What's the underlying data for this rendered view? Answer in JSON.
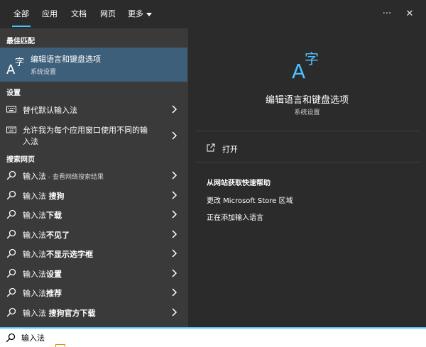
{
  "tabs": [
    {
      "label": "全部",
      "active": true
    },
    {
      "label": "应用",
      "active": false
    },
    {
      "label": "文档",
      "active": false
    },
    {
      "label": "网页",
      "active": false
    },
    {
      "label": "更多",
      "active": false
    }
  ],
  "topbar": {
    "more_options": "···",
    "close": "✕"
  },
  "best_match": {
    "section": "最佳匹配",
    "title": "编辑语言和键盘选项",
    "subtitle": "系统设置",
    "icon": "language-icon"
  },
  "settings": {
    "section": "设置",
    "items": [
      {
        "label": "替代默认输入法",
        "icon": "keyboard-icon"
      },
      {
        "label_line1": "允许我为每个应用窗口使用不同的输",
        "label_line2": "入法",
        "icon": "keyboard-icon"
      }
    ]
  },
  "web": {
    "section": "搜索网页",
    "items": [
      {
        "prefix": "输入法",
        "suffix": " - 查看网络搜索结果"
      },
      {
        "prefix": "输入法 ",
        "bold": "搜狗"
      },
      {
        "prefix": "输入法",
        "bold": "下载"
      },
      {
        "prefix": "输入法",
        "bold": "不见了"
      },
      {
        "prefix": "输入法",
        "bold": "不显示选字框"
      },
      {
        "prefix": "输入法",
        "bold": "设置"
      },
      {
        "prefix": "输入法",
        "bold": "推荐"
      },
      {
        "prefix": "输入法 ",
        "bold": "搜狗官方下载"
      }
    ]
  },
  "detail": {
    "title": "编辑语言和键盘选项",
    "subtitle": "系统设置",
    "open_label": "打开",
    "help_title": "从网站获取快速帮助",
    "help_links": [
      "更改 Microsoft Store 区域",
      "正在添加输入语言"
    ]
  },
  "search": {
    "value": "输入法"
  },
  "colors": {
    "accent": "#4cc2ff",
    "selected": "#3e5f79",
    "left_bg": "#3a3a3a",
    "right_bg": "#2b2b2b"
  }
}
